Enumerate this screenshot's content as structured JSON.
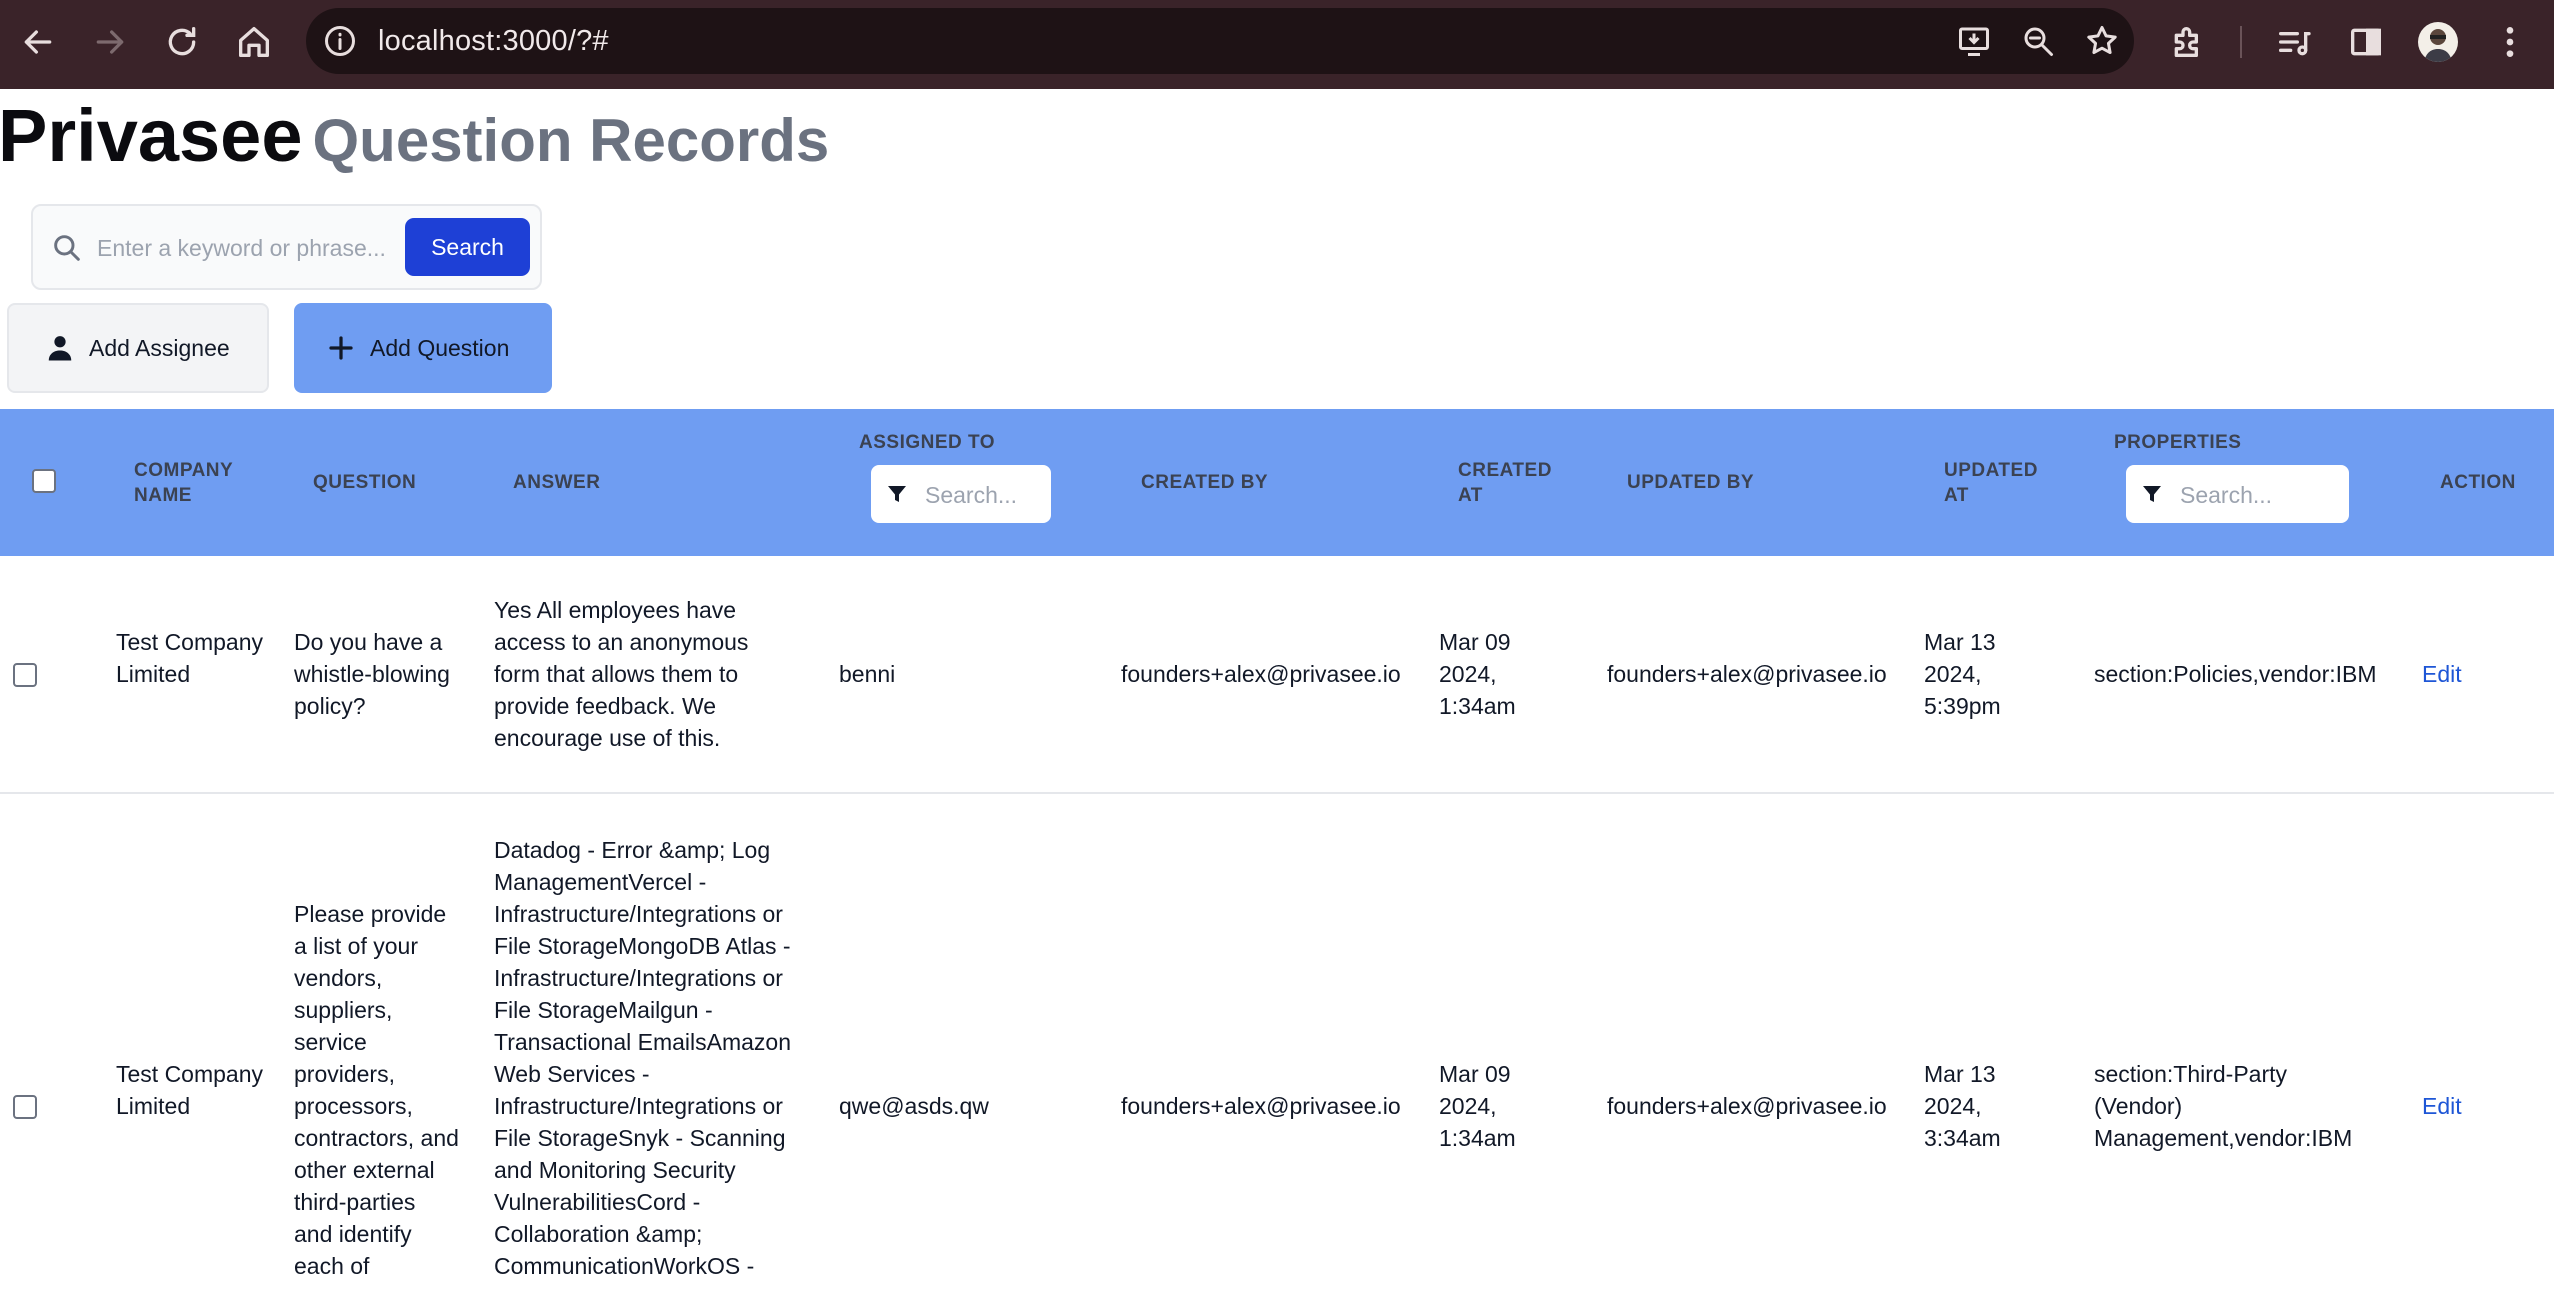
{
  "browser": {
    "url": "localhost:3000/?#"
  },
  "page": {
    "brand": "Privasee",
    "title": "Question Records"
  },
  "search": {
    "placeholder": "Enter a keyword or phrase...",
    "button_label": "Search"
  },
  "actions": {
    "add_assignee": "Add Assignee",
    "add_question": "Add Question"
  },
  "table": {
    "headers": {
      "company_name": "COMPANY NAME",
      "question": "QUESTION",
      "answer": "ANSWER",
      "assigned_to": "ASSIGNED TO",
      "created_by": "CREATED BY",
      "created_at": "CREATED AT",
      "updated_by": "UPDATED BY",
      "updated_at": "UPDATED AT",
      "properties": "PROPERTIES",
      "action": "ACTION"
    },
    "filter_placeholder": "Search...",
    "rows": [
      {
        "company": "Test Company Limited",
        "question": "Do you have a whistle-blowing policy?",
        "answer": "Yes All employees have access to an anonymous form that allows them to provide feedback. We encourage use of this.",
        "assigned_to": "benni",
        "created_by": "founders+alex@privasee.io",
        "created_at": "Mar 09 2024, 1:34am",
        "updated_by": "founders+alex@privasee.io",
        "updated_at": "Mar 13 2024, 5:39pm",
        "properties": "section:Policies,vendor:IBM",
        "action": "Edit"
      },
      {
        "company": "Test Company Limited",
        "question": "Please provide a list of your vendors, suppliers, service providers, processors, contractors, and other external third-parties and identify each of",
        "answer": "Datadog - Error &amp; Log ManagementVercel - Infrastructure/Integrations or File StorageMongoDB Atlas - Infrastructure/Integrations or File StorageMailgun - Transactional EmailsAmazon Web Services - Infrastructure/Integrations or File StorageSnyk - Scanning and Monitoring Security VulnerabilitiesCord - Collaboration &amp; CommunicationWorkOS -",
        "assigned_to": "qwe@asds.qw",
        "created_by": "founders+alex@privasee.io",
        "created_at": "Mar 09 2024, 1:34am",
        "updated_by": "founders+alex@privasee.io",
        "updated_at": "Mar 13 2024, 3:34am",
        "properties": "section:Third-Party (Vendor) Management,vendor:IBM",
        "action": "Edit"
      }
    ]
  }
}
